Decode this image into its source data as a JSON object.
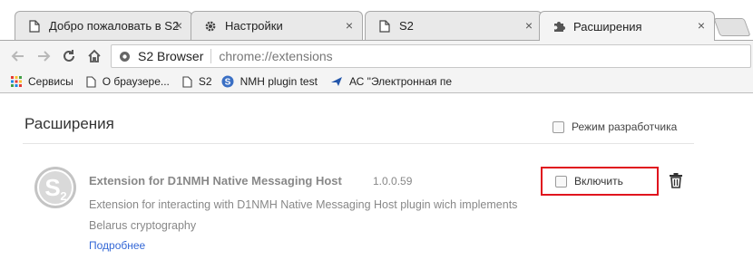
{
  "tabs": [
    {
      "label": "Добро пожаловать в S2",
      "icon": "page-icon",
      "active": false
    },
    {
      "label": "Настройки",
      "icon": "gear-icon",
      "active": false
    },
    {
      "label": "S2",
      "icon": "page-icon",
      "active": false
    },
    {
      "label": "Расширения",
      "icon": "puzzle-icon",
      "active": true
    }
  ],
  "tab_close_glyph": "×",
  "omnibox": {
    "site_label": "S2 Browser",
    "url": "chrome://extensions"
  },
  "bookmarks": [
    {
      "label": "Сервисы",
      "icon": "apps-grid-icon"
    },
    {
      "label": "О браузере...",
      "icon": "page-icon"
    },
    {
      "label": "S2",
      "icon": "page-icon"
    },
    {
      "label": "NMH plugin test",
      "icon": "s-logo-icon"
    },
    {
      "label": "АС \"Электронная пе",
      "icon": "plane-icon"
    }
  ],
  "page": {
    "title": "Расширения",
    "developer_mode_label": "Режим разработчика"
  },
  "extension": {
    "name": "Extension for D1NMH Native Messaging Host",
    "version": "1.0.0.59",
    "description_line1": "Extension for interacting with D1NMH Native Messaging Host plugin wich implements",
    "description_line2": "Belarus cryptography",
    "details_link": "Подробнее",
    "enable_label": "Включить",
    "enabled": false
  },
  "colors": {
    "link": "#3367d6",
    "highlight_border": "#e0141e"
  }
}
